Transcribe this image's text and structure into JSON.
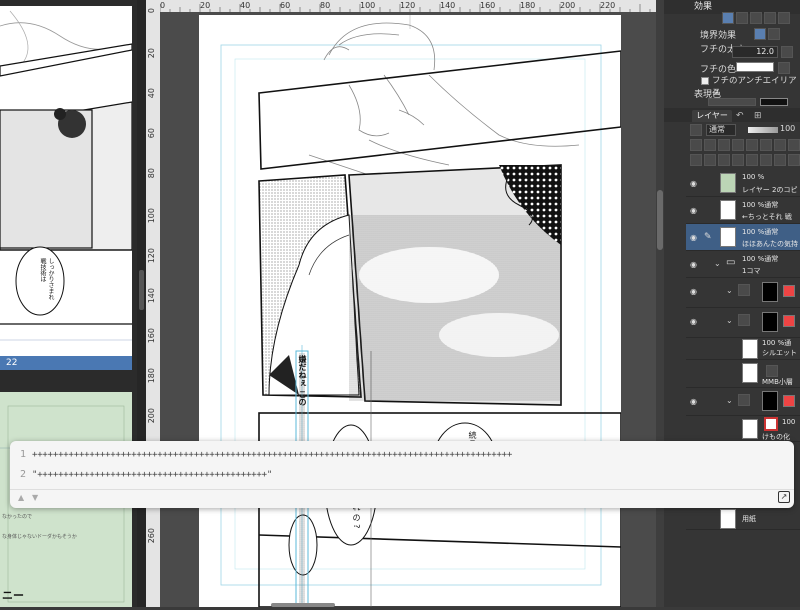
{
  "left_panel": {
    "page_number": "22",
    "balloon_text": "しっかりさまれ 戦技術は"
  },
  "ruler": {
    "top_ticks": [
      "0",
      "20",
      "40",
      "60",
      "80",
      "100",
      "120",
      "140",
      "160",
      "180",
      "200",
      "220"
    ],
    "left_ticks": [
      "0",
      "20",
      "40",
      "60",
      "80",
      "100",
      "120",
      "140",
      "160",
      "180",
      "200",
      "220",
      "240",
      "260"
    ]
  },
  "canvas": {
    "vertical_text": "嫌だねぇ この",
    "balloon_1": "続こ",
    "balloon_2": "れ の ?"
  },
  "effects_panel": {
    "title": "効果",
    "border_effect_label": "境界効果",
    "edge_width_label": "フチの太さ",
    "edge_width_value": "12.0",
    "edge_color_label": "フチの色",
    "antialias_label": "フチのアンチエイリアス",
    "expression_color_label": "表現色"
  },
  "layer_panel": {
    "tab_label": "レイヤー",
    "blend_mode": "通常",
    "opacity": "100",
    "layers": [
      {
        "opacity": "100 %",
        "name": "レイヤー 2のコピー"
      },
      {
        "opacity": "100 %通常",
        "name": "←ちっとそれ 戦"
      },
      {
        "opacity": "100 %通常",
        "name": "ほほあんたの気持"
      },
      {
        "opacity": "100 %通常",
        "name": "1コマ"
      },
      {
        "opacity": "",
        "name": ""
      },
      {
        "opacity": "",
        "name": ""
      },
      {
        "opacity": "100 %通",
        "name": "シルエット"
      },
      {
        "opacity": "",
        "name": "MMB小層"
      },
      {
        "opacity": "",
        "name": ""
      },
      {
        "opacity": "100",
        "name": "けもの化"
      },
      {
        "opacity": "",
        "name": "用紙"
      }
    ]
  },
  "editor": {
    "line1_no": "1",
    "line1": "++++++++++++++++++++++++++++++++++++++++++++++++++++++++++++++++++++++++++++++++++++++++++++",
    "line2_no": "2",
    "line2": "\"++++++++++++++++++++++++++++++++++++++++++++\""
  },
  "colors": {
    "selection_blue": "#3f5f86",
    "thumb_blue": "#4a78b3",
    "guide_cyan": "#5bb8d8"
  }
}
